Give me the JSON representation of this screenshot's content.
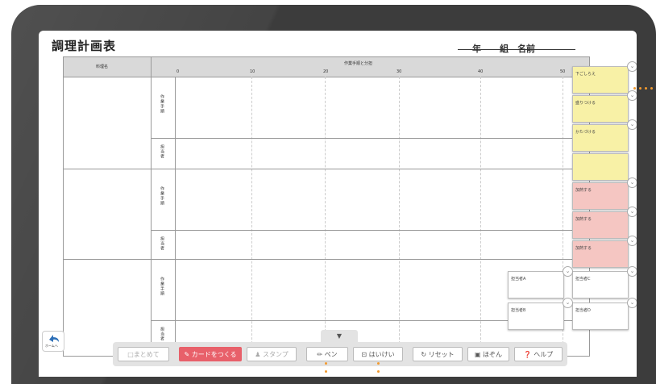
{
  "page": {
    "title": "調理計画表",
    "name_fields": {
      "year": "年",
      "class": "組",
      "name": "名前"
    }
  },
  "table": {
    "dish_header": "料理名",
    "timeline_header": "作業手順と分担",
    "ticks": [
      "0",
      "10",
      "20",
      "30",
      "40",
      "50"
    ],
    "row_labels": {
      "steps": "作業手順",
      "person": "担当者"
    }
  },
  "cards": [
    {
      "label": "下ごしらえ",
      "color": "#f8f1a6"
    },
    {
      "label": "盛りつける",
      "color": "#f8f1a6"
    },
    {
      "label": "かたづける",
      "color": "#f8f1a6"
    },
    {
      "label": "",
      "color": "#f8f1a6"
    },
    {
      "label": "加熱する",
      "color": "#f5c6c2"
    },
    {
      "label": "加熱する",
      "color": "#f5c6c2"
    },
    {
      "label": "加熱する",
      "color": "#f5c6c2"
    }
  ],
  "person_cards": [
    "担当者A",
    "担当者B",
    "担当者C",
    "担当者D"
  ],
  "toolbar": {
    "tab_icon": "chevron-down-icon",
    "back_label": "ホームへ",
    "buttons": {
      "summary": "□まとめて",
      "make_card": "カードをつくる",
      "stamp": "スタンプ",
      "pen": "ペン",
      "background": "はいけい",
      "reset": "リセット",
      "save": "ほぞん",
      "help": "ヘルプ"
    }
  },
  "colors": {
    "accent_red": "#e8606a",
    "note_yellow": "#f8f1a6",
    "note_pink": "#f5c6c2",
    "callout_orange": "#f29a2e"
  }
}
